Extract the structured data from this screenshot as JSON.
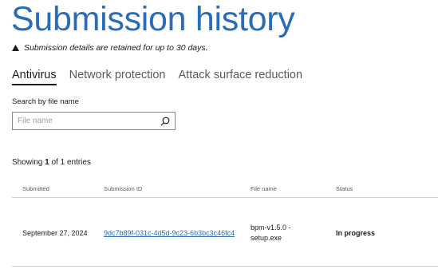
{
  "page": {
    "title": "Submission history",
    "notice": "Submission details are retained for up to 30 days."
  },
  "tabs": [
    {
      "label": "Antivirus",
      "active": true
    },
    {
      "label": "Network protection",
      "active": false
    },
    {
      "label": "Attack surface reduction",
      "active": false
    }
  ],
  "search": {
    "label": "Search by file name",
    "placeholder": "File name",
    "value": ""
  },
  "summary": {
    "prefix": "Showing",
    "shown": "1",
    "middle": "of 1 entries"
  },
  "table": {
    "columns": [
      "Submitted",
      "Submission ID",
      "File name",
      "Status"
    ],
    "rows": [
      {
        "submitted": "September 27, 2024",
        "submission_id": "9dc7b89f-031c-4d5d-9c23-6b3bc3c46fc4",
        "file_name": "bpm-v1.5.0 - setup.exe",
        "status": "In progress"
      }
    ]
  },
  "colors": {
    "accent": "#2b6cb8",
    "text": "#1b1b1b",
    "muted": "#5a5a5a",
    "divider": "#d0d0d0"
  },
  "icons": {
    "notice": "warning-icon",
    "search": "search-icon"
  }
}
